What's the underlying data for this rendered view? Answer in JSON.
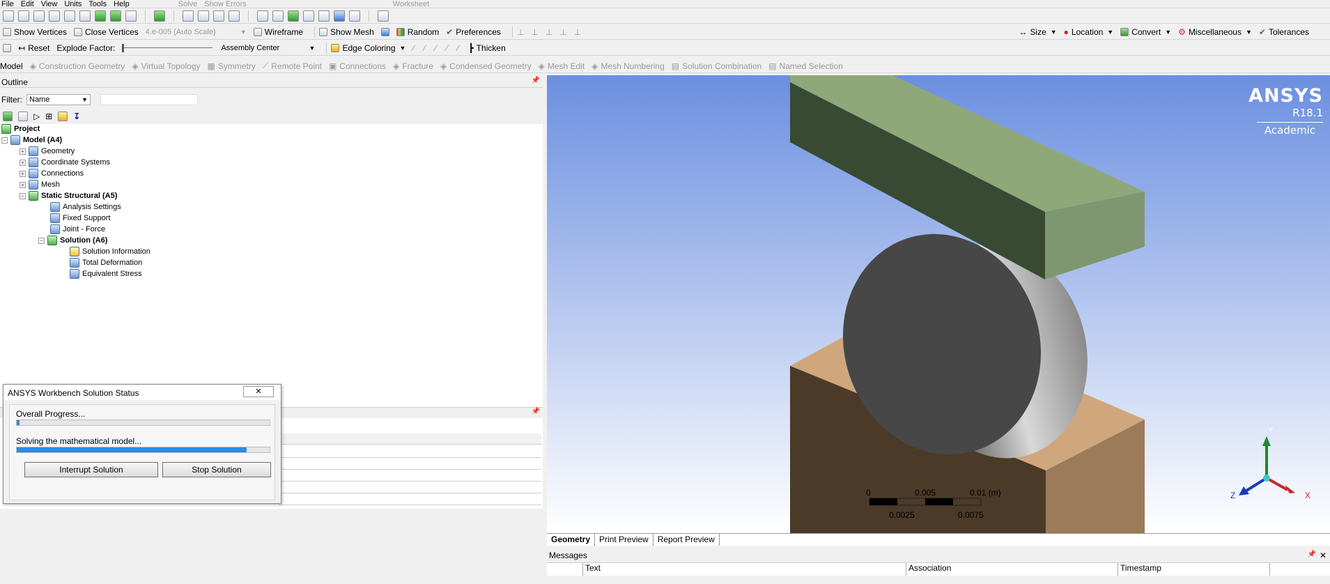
{
  "menu": {
    "items": [
      "File",
      "Edit",
      "View",
      "Units",
      "Tools",
      "Help"
    ],
    "solve_label": "Solve",
    "show_errors_label": "Show Errors",
    "worksheet_label": "Worksheet"
  },
  "toolbar2": {
    "show_vertices": "Show Vertices",
    "close_vertices": "Close Vertices",
    "scale_value": "4.e-005 (Auto Scale)",
    "wireframe": "Wireframe",
    "show_mesh": "Show Mesh",
    "random": "Random",
    "preferences": "Preferences",
    "size": "Size",
    "location": "Location",
    "convert": "Convert",
    "miscellaneous": "Miscellaneous",
    "tolerances": "Tolerances"
  },
  "toolbar3": {
    "reset": "Reset",
    "explode_factor": "Explode Factor:",
    "assembly_center": "Assembly Center",
    "edge_coloring": "Edge Coloring",
    "thicken": "Thicken"
  },
  "context_bar": {
    "model": "Model",
    "items": [
      "Construction Geometry",
      "Virtual Topology",
      "Symmetry",
      "Remote Point",
      "Connections",
      "Fracture",
      "Condensed Geometry",
      "Mesh Edit",
      "Mesh Numbering",
      "Solution Combination",
      "Named Selection"
    ]
  },
  "outline": {
    "title": "Outline",
    "filter_label": "Filter:",
    "filter_value": "Name",
    "tree": {
      "project": "Project",
      "model": "Model (A4)",
      "geometry": "Geometry",
      "coordinate_systems": "Coordinate Systems",
      "connections": "Connections",
      "mesh": "Mesh",
      "static_structural": "Static Structural (A5)",
      "analysis_settings": "Analysis Settings",
      "fixed_support": "Fixed Support",
      "joint_force": "Joint - Force",
      "solution": "Solution (A6)",
      "solution_information": "Solution Information",
      "total_deformation": "Total Deformation",
      "equivalent_stress": "Equivalent Stress"
    }
  },
  "dialog": {
    "title": "ANSYS Workbench Solution Status",
    "overall_label": "Overall Progress...",
    "overall_progress": 0.01,
    "solving_label": "Solving the mathematical model...",
    "solving_progress": 0.91,
    "interrupt_button": "Interrupt Solution",
    "stop_button": "Stop Solution"
  },
  "viewport": {
    "brand": "ANSYS",
    "version": "R18.1",
    "edition": "Academic",
    "scale_labels_top": [
      "0",
      "0.005",
      "0.01 (m)"
    ],
    "scale_labels_bottom": [
      "0.0025",
      "0.0075"
    ],
    "axis_x": "X",
    "axis_y": "Y",
    "axis_z": "Z",
    "colors": {
      "top_block": "#8ea87a",
      "top_block_side": "#384a32",
      "bottom_block": "#d0a77c",
      "bottom_block_side": "#4b3a28",
      "disc_face": "#474747"
    }
  },
  "view_tabs": [
    "Geometry",
    "Print Preview",
    "Report Preview"
  ],
  "messages": {
    "title": "Messages",
    "columns": [
      "Text",
      "Association",
      "Timestamp"
    ]
  }
}
